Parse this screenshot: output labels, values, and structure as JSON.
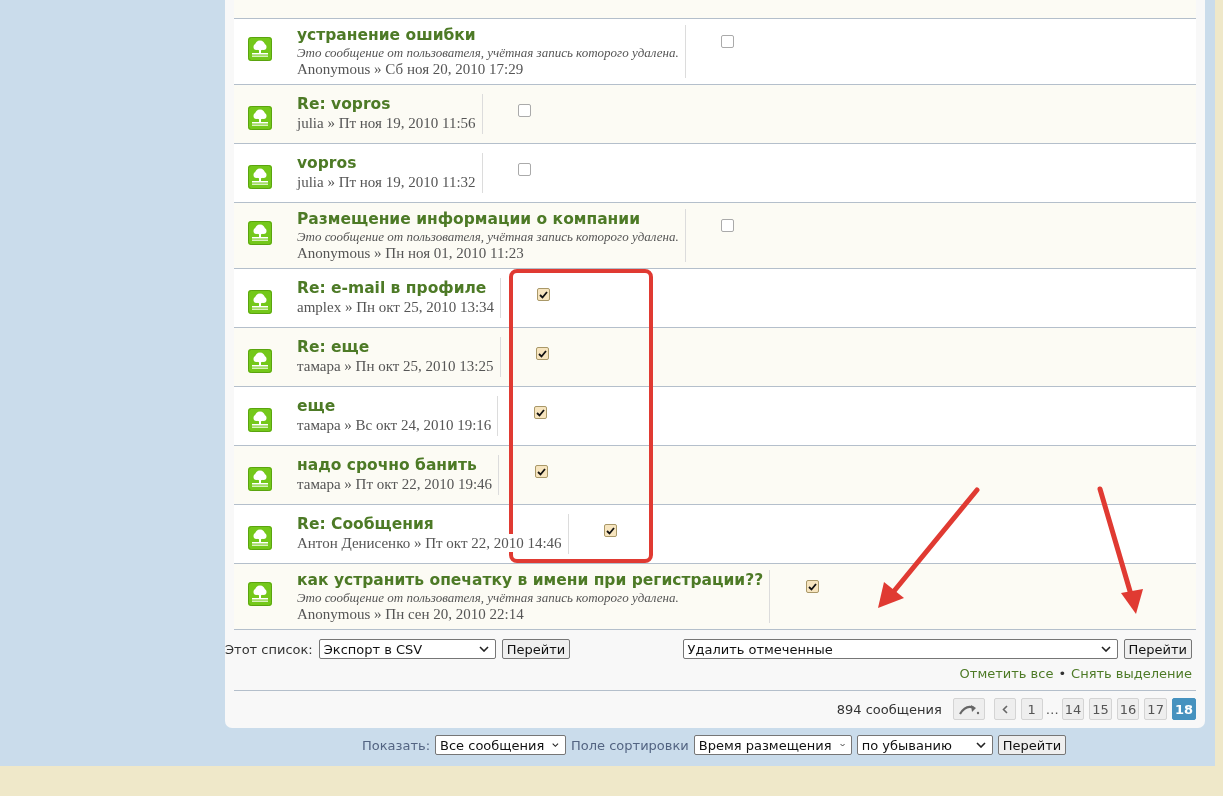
{
  "posts": [
    {
      "title": "устранение ошибки",
      "note": "Это сообщение от пользователя, учётная запись которого удалена.",
      "meta": "Anonymous » Сб ноя 20, 2010 17:29",
      "checked": false
    },
    {
      "title": "Re: vopros",
      "meta": "julia » Пт ноя 19, 2010 11:56",
      "checked": false
    },
    {
      "title": "vopros",
      "meta": "julia » Пт ноя 19, 2010 11:32",
      "checked": false
    },
    {
      "title": "Размещение информации о компании",
      "note": "Это сообщение от пользователя, учётная запись которого удалена.",
      "meta": "Anonymous » Пн ноя 01, 2010 11:23",
      "checked": false
    },
    {
      "title": "Re: e-mail в профиле",
      "meta": "amplex » Пн окт 25, 2010 13:34",
      "checked": true
    },
    {
      "title": "Re: еще",
      "meta": "тамара » Пн окт 25, 2010 13:25",
      "checked": true
    },
    {
      "title": "еще",
      "meta": "тамара » Вс окт 24, 2010 19:16",
      "checked": true
    },
    {
      "title": "надо срочно банить",
      "meta": "тамара » Пт окт 22, 2010 19:46",
      "checked": true
    },
    {
      "title": "Re: Сообщения",
      "meta": "Антон Денисенко » Пт окт 22, 2010 14:46",
      "checked": true
    },
    {
      "title": "как устранить опечатку в имени при регистрации??",
      "note": "Это сообщение от пользователя, учётная запись которого удалена.",
      "meta": "Anonymous » Пн сен 20, 2010 22:14",
      "checked": true
    }
  ],
  "list_action": {
    "label": "Этот список:",
    "select": "Экспорт в CSV",
    "button": "Перейти"
  },
  "mod_action": {
    "select": "Удалить отмеченные",
    "button": "Перейти"
  },
  "mark_links": {
    "mark_all": "Отметить все",
    "separator": "•",
    "unmark_all": "Снять выделение"
  },
  "pagination": {
    "count": "894 сообщения",
    "pages": [
      {
        "kind": "page",
        "label": "1",
        "selected": false
      },
      {
        "kind": "gap",
        "label": "…"
      },
      {
        "kind": "page",
        "label": "14",
        "selected": false
      },
      {
        "kind": "page",
        "label": "15",
        "selected": false
      },
      {
        "kind": "page",
        "label": "16",
        "selected": false
      },
      {
        "kind": "page",
        "label": "17",
        "selected": false
      },
      {
        "kind": "page",
        "label": "18",
        "selected": true
      }
    ]
  },
  "display_options": {
    "show_label": "Показать:",
    "show_select": "Все сообщения",
    "sort_label": "Поле сортировки",
    "sort_select": "Время размещения",
    "order_select": "по убыванию",
    "button": "Перейти"
  }
}
